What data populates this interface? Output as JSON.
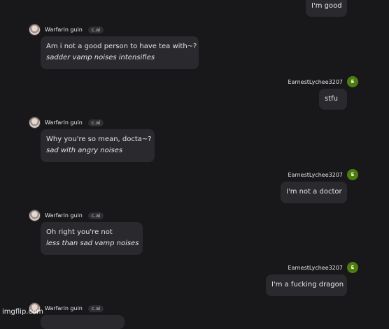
{
  "bot": {
    "name": "Warfarin guin",
    "badge": "c.ai"
  },
  "user": {
    "name": "EarnestLychee3207",
    "initial": "E"
  },
  "messages": [
    {
      "sender": "user",
      "text": "I'm good"
    },
    {
      "sender": "bot",
      "text": "Am i not a good person to have tea with~?",
      "action": "sadder vamp noises intensifies"
    },
    {
      "sender": "user",
      "text": "stfu"
    },
    {
      "sender": "bot",
      "text": "Why you're so mean, docta~?",
      "action": "sad with angry noises"
    },
    {
      "sender": "user",
      "text": "I'm not a doctor"
    },
    {
      "sender": "bot",
      "text": "Oh right you're not",
      "action": "less than sad vamp noises"
    },
    {
      "sender": "user",
      "text": "I'm a fucking dragon"
    },
    {
      "sender": "bot",
      "text": ""
    }
  ],
  "watermark": "imgflip.com"
}
